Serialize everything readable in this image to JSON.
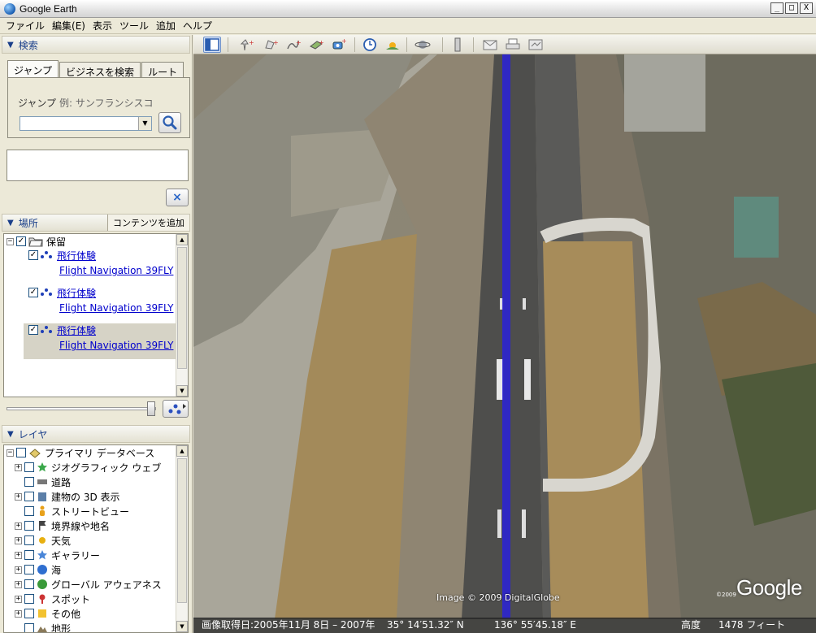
{
  "window": {
    "title": "Google Earth",
    "min_label": "_",
    "max_label": "□",
    "close_label": "X"
  },
  "menu": [
    "ファイル",
    "編集(E)",
    "表示",
    "ツール",
    "追加",
    "ヘルプ"
  ],
  "search": {
    "header": "検索",
    "tabs": [
      "ジャンプ",
      "ビジネスを検索",
      "ルート"
    ],
    "jump_label": "ジャンプ",
    "jump_hint": "例: サンフランシスコ",
    "input_value": "",
    "clear_label": "×"
  },
  "places": {
    "header": "場所",
    "add_content": "コンテンツを追加",
    "folder": "保留",
    "items": [
      {
        "title": "飛行体験",
        "subtitle": "Flight Navigation 39FLY"
      },
      {
        "title": "飛行体験",
        "subtitle": "Flight Navigation 39FLY"
      },
      {
        "title": "飛行体験",
        "subtitle": "Flight Navigation 39FLY"
      }
    ]
  },
  "layers": {
    "header": "レイヤ",
    "root": "プライマリ データベース",
    "items": [
      {
        "label": "ジオグラフィック ウェブ",
        "icon": "star-icon",
        "color": "#3aa84a",
        "expand": true
      },
      {
        "label": "道路",
        "icon": "road-icon",
        "color": "#777777",
        "expand": false
      },
      {
        "label": "建物の 3D 表示",
        "icon": "building-icon",
        "color": "#5c7fa8",
        "expand": true
      },
      {
        "label": "ストリートビュー",
        "icon": "person-icon",
        "color": "#e8a11a",
        "expand": false
      },
      {
        "label": "境界線や地名",
        "icon": "flag-icon",
        "color": "#444444",
        "expand": true
      },
      {
        "label": "天気",
        "icon": "sun-icon",
        "color": "#e8b010",
        "expand": true
      },
      {
        "label": "ギャラリー",
        "icon": "star-icon",
        "color": "#4a86d8",
        "expand": true
      },
      {
        "label": "海",
        "icon": "ocean-icon",
        "color": "#2f6fd0",
        "expand": true
      },
      {
        "label": "グローバル アウェアネス",
        "icon": "globe-icon",
        "color": "#3a9a3a",
        "expand": true
      },
      {
        "label": "スポット",
        "icon": "pin-icon",
        "color": "#cc3333",
        "expand": true
      },
      {
        "label": "その他",
        "icon": "note-icon",
        "color": "#f2c230",
        "expand": true
      },
      {
        "label": "地形",
        "icon": "terrain-icon",
        "color": "#8a7a5a",
        "expand": false
      }
    ]
  },
  "map": {
    "copyright": "Image © 2009 DigitalGlobe",
    "logo": "Google",
    "logo_year": "©2009",
    "status": {
      "date": "画像取得日:2005年11月 8日 – 2007年",
      "lat": "35° 14′51.32″ N",
      "lon": "136° 55′45.18″ E",
      "alt_label": "高度",
      "alt_value": "1478 フィート"
    }
  }
}
